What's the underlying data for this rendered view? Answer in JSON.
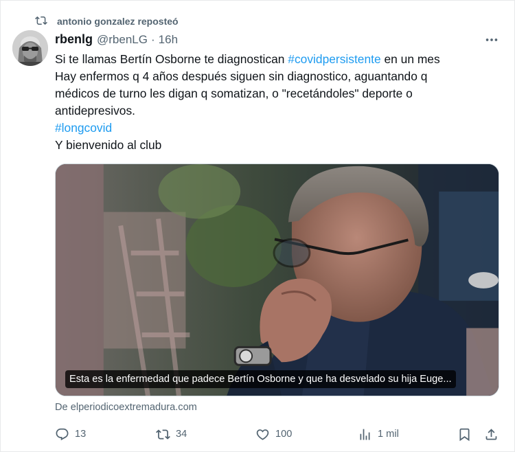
{
  "repost": {
    "text": "antonio gonzalez reposteó",
    "icon": "repost-icon"
  },
  "tweet": {
    "display_name": "rbenlg",
    "handle": "@rbenLG",
    "separator": "·",
    "time": "16h",
    "lines": [
      {
        "before": "Si te llamas Bertín Osborne te diagnostican ",
        "hashtag": "#covidpersistente",
        "after": " en un mes"
      },
      {
        "before": "Hay enfermos q 4 años después siguen sin diagnostico, aguantando q",
        "hashtag": "",
        "after": ""
      },
      {
        "before": "médicos de turno les digan q  somatizan, o \"recetándoles\" deporte o",
        "hashtag": "",
        "after": ""
      },
      {
        "before": "antidepresivos.",
        "hashtag": "",
        "after": ""
      },
      {
        "before": "",
        "hashtag": "#longcovid",
        "after": ""
      },
      {
        "before": "Y bienvenido al club",
        "hashtag": "",
        "after": ""
      }
    ],
    "card": {
      "caption": "Esta es la enfermedad que padece Bertín Osborne y que ha desvelado su hija Euge...",
      "source": "De elperiodicoextremadura.com"
    },
    "actions": {
      "reply": {
        "icon": "reply-icon",
        "count": "13"
      },
      "retweet": {
        "icon": "retweet-icon",
        "count": "34"
      },
      "like": {
        "icon": "heart-icon",
        "count": "100"
      },
      "views": {
        "icon": "views-icon",
        "count": "1 mil"
      },
      "bookmark": {
        "icon": "bookmark-icon",
        "count": ""
      },
      "share": {
        "icon": "share-icon",
        "count": ""
      }
    }
  },
  "colors": {
    "accent": "#1d9bf0",
    "secondary_text": "#536471",
    "text": "#0f1419",
    "border": "#cfd9de"
  }
}
